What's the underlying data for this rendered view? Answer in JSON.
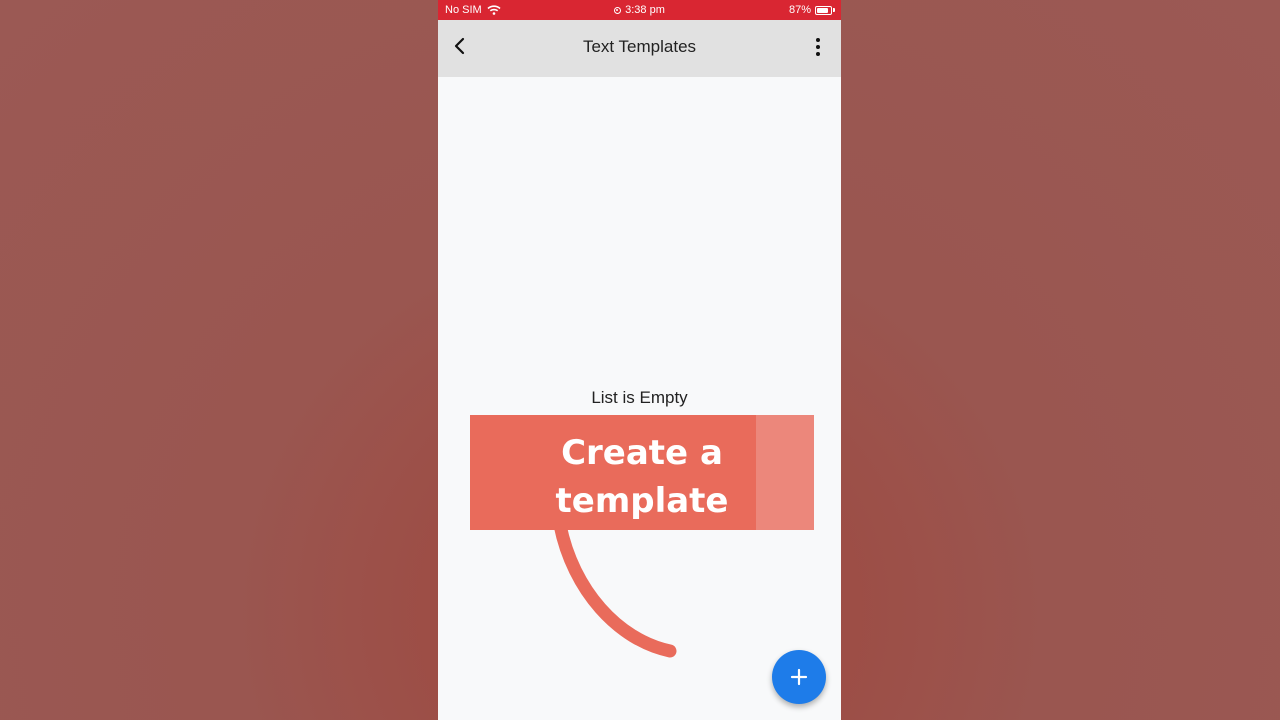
{
  "status_bar": {
    "carrier": "No SIM",
    "time": "3:38 pm",
    "battery_text": "87%",
    "battery_level": 0.87
  },
  "app_bar": {
    "title": "Text Templates",
    "back_icon": "chevron-left-icon",
    "menu_icon": "more-vertical-icon"
  },
  "content": {
    "empty_message": "List is Empty"
  },
  "callout": {
    "line1": "Create a",
    "line2": "template"
  },
  "fab": {
    "icon": "plus-icon"
  },
  "colors": {
    "status_bar": "#d92632",
    "app_bar": "#e1e1e1",
    "callout": "#e96b5b",
    "fab": "#1e7ce9"
  }
}
